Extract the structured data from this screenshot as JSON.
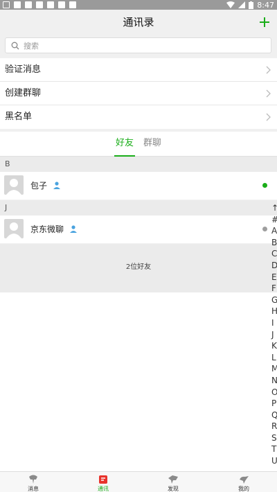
{
  "status_bar": {
    "time": "8:47"
  },
  "header": {
    "title": "通讯录",
    "add_icon": "plus-icon"
  },
  "search": {
    "placeholder": "搜索",
    "icon": "search-icon"
  },
  "menu": {
    "items": [
      {
        "label": "验证消息"
      },
      {
        "label": "创建群聊"
      },
      {
        "label": "黑名单"
      }
    ]
  },
  "tabs": {
    "friends": "好友",
    "groups": "群聊",
    "active": "friends"
  },
  "sections": [
    {
      "letter": "B",
      "contacts": [
        {
          "name": "包子",
          "online": true
        }
      ]
    },
    {
      "letter": "J",
      "contacts": [
        {
          "name": "京东微聊",
          "online": false
        }
      ]
    }
  ],
  "friend_count": "2位好友",
  "index_letters": [
    "↑",
    "#",
    "A",
    "B",
    "C",
    "D",
    "E",
    "F",
    "G",
    "H",
    "I",
    "J",
    "K",
    "L",
    "M",
    "N",
    "O",
    "P",
    "Q",
    "R",
    "S",
    "T",
    "U"
  ],
  "bottom_nav": [
    {
      "label": "消息",
      "icon": "message-icon"
    },
    {
      "label": "通讯",
      "icon": "contacts-icon",
      "active": true
    },
    {
      "label": "发现",
      "icon": "discover-icon"
    },
    {
      "label": "我的",
      "icon": "me-icon"
    }
  ],
  "colors": {
    "accent": "#1aad19",
    "online_dot": "#1aad19",
    "offline_dot": "#9e9e9e",
    "active_nav_icon": "#e8332c"
  }
}
